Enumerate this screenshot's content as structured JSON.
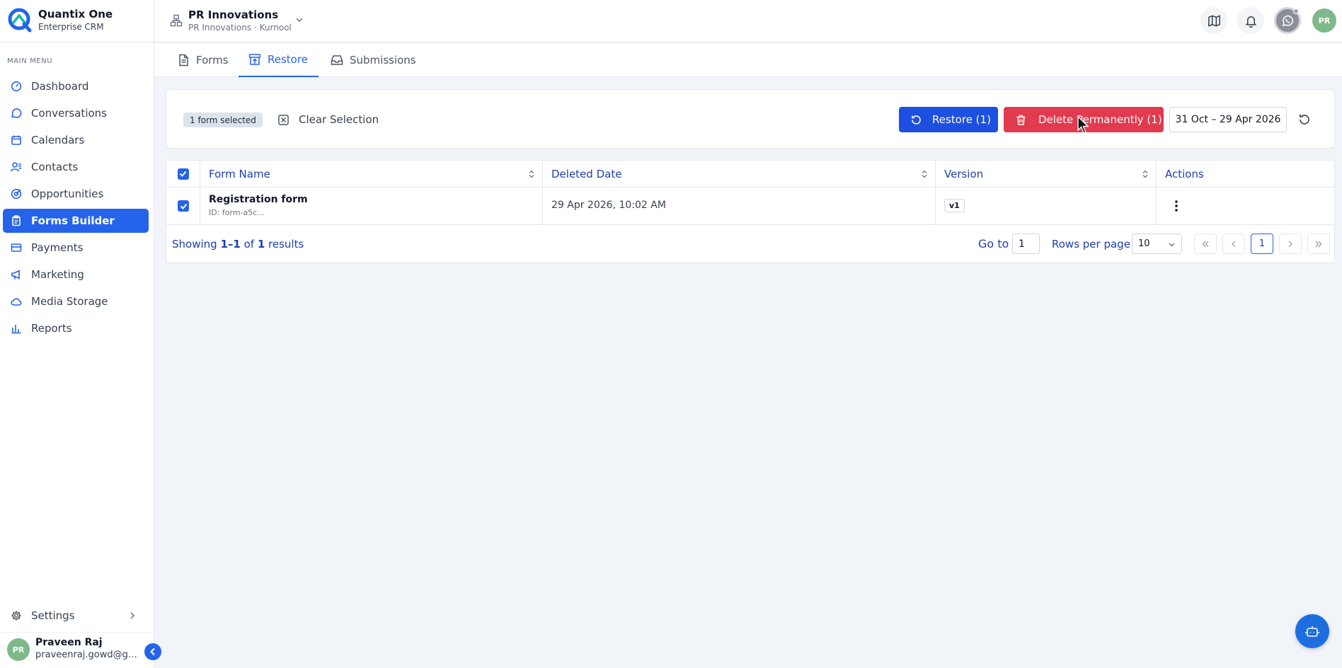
{
  "brand": {
    "name": "Quantix One",
    "subtitle": "Enterprise CRM"
  },
  "sidebar": {
    "heading": "MAIN MENU",
    "items": [
      {
        "label": "Dashboard",
        "icon": "dashboard-icon",
        "active": false
      },
      {
        "label": "Conversations",
        "icon": "chat-icon",
        "active": false
      },
      {
        "label": "Calendars",
        "icon": "calendar-icon",
        "active": false
      },
      {
        "label": "Contacts",
        "icon": "contacts-icon",
        "active": false
      },
      {
        "label": "Opportunities",
        "icon": "target-icon",
        "active": false
      },
      {
        "label": "Forms Builder",
        "icon": "clipboard-icon",
        "active": true
      },
      {
        "label": "Payments",
        "icon": "credit-card-icon",
        "active": false
      },
      {
        "label": "Marketing",
        "icon": "megaphone-icon",
        "active": false
      },
      {
        "label": "Media Storage",
        "icon": "cloud-icon",
        "active": false
      },
      {
        "label": "Reports",
        "icon": "bar-chart-icon",
        "active": false
      }
    ],
    "settings_label": "Settings",
    "user": {
      "initials": "PR",
      "name": "Praveen Raj",
      "email": "praveenraj.gowd@gma..."
    }
  },
  "header": {
    "org_name": "PR Innovations",
    "org_sub": "PR Innovations · Kurnool",
    "avatar_initials": "PR"
  },
  "tabs": [
    {
      "label": "Forms",
      "active": false
    },
    {
      "label": "Restore",
      "active": true
    },
    {
      "label": "Submissions",
      "active": false
    }
  ],
  "toolbar": {
    "selected_badge": "1 form selected",
    "clear_label": "Clear Selection",
    "restore_label": "Restore (1)",
    "delete_label": "Delete Permanently (1)",
    "date_range": "31 Oct – 29 Apr 2026"
  },
  "table": {
    "columns": [
      "Form Name",
      "Deleted Date",
      "Version",
      "Actions"
    ],
    "rows": [
      {
        "name": "Registration form",
        "id": "ID: form-a5c...",
        "deleted": "29 Apr 2026, 10:02 AM",
        "version": "v1",
        "checked": true
      }
    ]
  },
  "pagination": {
    "showing_prefix": "Showing ",
    "range": "1–1",
    "of": " of ",
    "total": "1",
    "suffix": " results",
    "goto_label": "Go to",
    "goto_value": "1",
    "rows_label": "Rows per page",
    "rows_value": "10",
    "current_page": "1"
  },
  "colors": {
    "accent": "#2563eb",
    "danger": "#e23a4e",
    "restore": "#1d4fe0"
  }
}
